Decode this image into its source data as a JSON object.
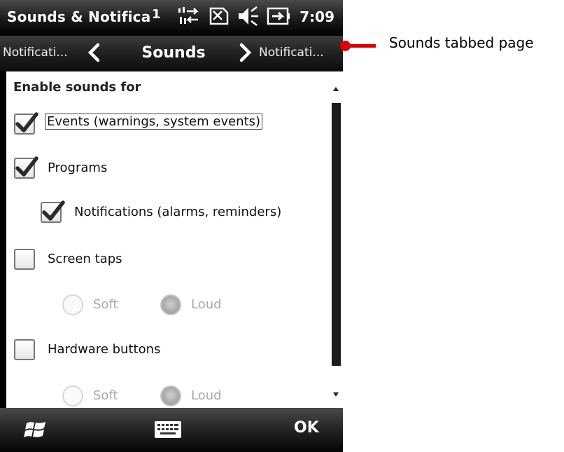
{
  "titlebar": {
    "title": "Sounds & Notifica",
    "signal_indicator": "1",
    "time": "7:09",
    "icons": [
      "signal-icon",
      "data-transfer-icon",
      "no-sim-icon",
      "volume-icon",
      "battery-charging-icon"
    ]
  },
  "tabs": {
    "previous": "Notificati...",
    "current": "Sounds",
    "next": "Notificati..."
  },
  "content": {
    "section_heading": "Enable sounds for",
    "options": [
      {
        "label": "Events (warnings, system events)",
        "checked": true,
        "focused": true
      },
      {
        "label": "Programs",
        "checked": true
      },
      {
        "label": "Notifications (alarms, reminders)",
        "checked": true,
        "indented": true
      },
      {
        "label": "Screen taps",
        "checked": false
      },
      {
        "label": "Hardware buttons",
        "checked": false
      }
    ],
    "screen_taps_volume": {
      "soft": "Soft",
      "loud": "Loud",
      "selected": "Loud",
      "enabled": false
    },
    "hardware_buttons_volume": {
      "soft": "Soft",
      "loud": "Loud",
      "selected": "Loud",
      "enabled": false
    }
  },
  "bottombar": {
    "start_icon": "windows-start-icon",
    "keyboard_icon": "keyboard-icon",
    "ok_label": "OK"
  },
  "annotation": {
    "text": "Sounds tabbed page",
    "color": "#e00000"
  }
}
